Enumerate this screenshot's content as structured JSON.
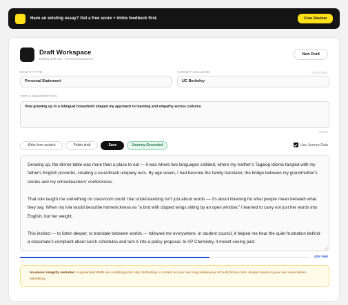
{
  "banner": {
    "text": "Have an existing essay? Get a free score + inline feedback first.",
    "button": "Free Review",
    "icon": "lightning-icon",
    "accent": "#ffe11a"
  },
  "header": {
    "title": "Draft Workspace",
    "subtitle": "Editing draft #12 · Personal Statement",
    "new_draft": "New Draft"
  },
  "form": {
    "essay_type_label": "Essay Type",
    "essay_type_value": "Personal Statement",
    "target_college_label": "Target College",
    "target_college_optional": "Optional",
    "target_college_value": "UC Berkeley",
    "topic_label": "Topic Description",
    "topic_value": "How growing up in a bilingual household shaped my approach to learning and empathy across cultures",
    "topic_counter": "97/220"
  },
  "modes": {
    "write": "Write from scratch",
    "polish": "Polish draft",
    "save": "Save",
    "journey": "Journey-Grounded",
    "journey_checkbox": "Use Journey Data",
    "journey_checked": true
  },
  "essay": {
    "paragraphs": [
      "Growing up, the dinner table was more than a place to eat — it was where two languages collided, where my mother's Tagalog idioms tangled with my father's English proverbs, creating a soundtrack uniquely ours. By age seven, I had become the family translator, the bridge between my grandmother's stories and my schoolteachers' conferences.",
      "That role taught me something no classroom could: that understanding isn't just about words — it's about listening for what people mean beneath what they say. When my lola would describe homesickness as \"a bird with clipped wings sitting by an open window,\" I learned to carry not just her words into English, but her weight.",
      "This instinct — to listen deeper, to translate between worlds — followed me everywhere. In student council, it helped me hear the quiet frustration behind a classmate's complaint about lunch schedules and turn it into a policy proposal. In AP Chemistry, it meant seeing past"
    ]
  },
  "progress": {
    "words": 425,
    "limit": 650,
    "label": "425 / 650",
    "color": "#1f4fd6"
  },
  "notice": {
    "bold": "Academic integrity reminder:",
    "text": " AI-generated drafts are a starting point only. Submitting AI content as your own may violate your school's honor code. Always rewrite in your own voice before submitting."
  }
}
